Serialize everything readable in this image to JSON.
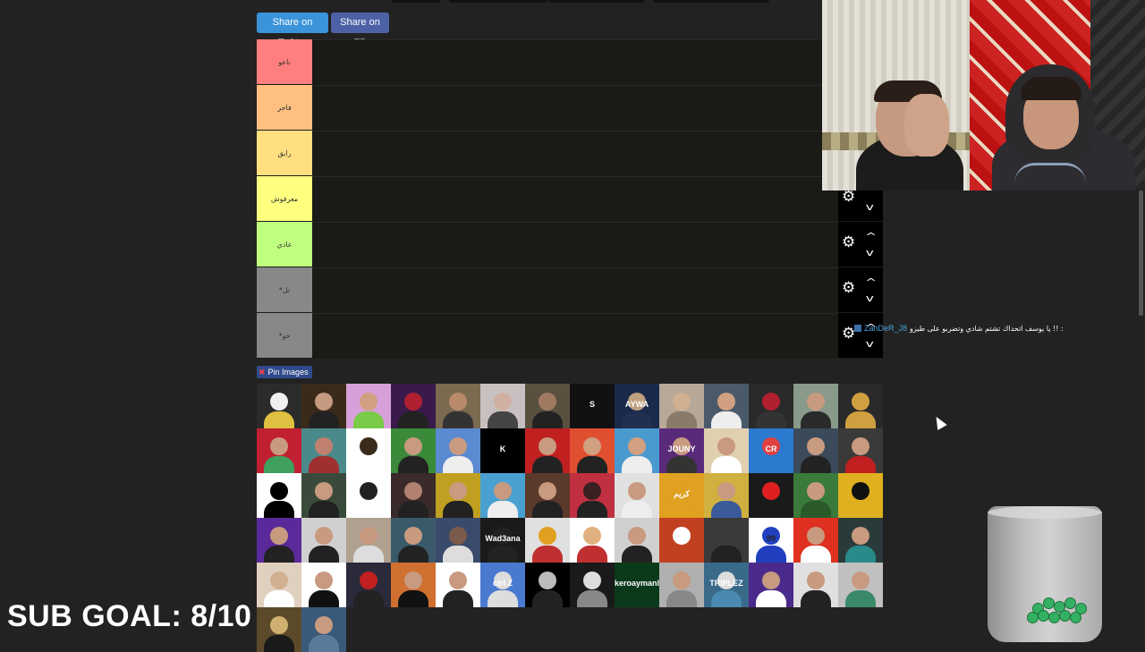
{
  "share": {
    "twitter_label": "Share on Twitter",
    "fb_label": "Share on FB"
  },
  "tiers": [
    {
      "label": "ناعو",
      "color": "#ff7f7f"
    },
    {
      "label": "فاجر",
      "color": "#ffbf7f"
    },
    {
      "label": "رايق",
      "color": "#ffdf7f"
    },
    {
      "label": "معرفوش",
      "color": "#ffff7f"
    },
    {
      "label": "عادي",
      "color": "#bfff7f"
    },
    {
      "label": "*تل",
      "color": "#888888"
    },
    {
      "label": "*خو",
      "color": "#888888"
    }
  ],
  "pin": {
    "label": "Pin Images"
  },
  "pool_tiles": [
    {
      "bg": "#2b2b2b",
      "head": "#f0f0f0",
      "body": "#e0c040",
      "text": ""
    },
    {
      "bg": "#3a2a1a",
      "head": "#c59a80",
      "body": "#222",
      "text": ""
    },
    {
      "bg": "#d8a0d8",
      "head": "#d0a080",
      "body": "#7acb48",
      "text": ""
    },
    {
      "bg": "#3a1a4a",
      "head": "#b02030",
      "body": "#222",
      "text": ""
    },
    {
      "bg": "#7a6a50",
      "head": "#b88a6a",
      "body": "#333",
      "text": ""
    },
    {
      "bg": "#c8c0c0",
      "head": "#d0b0a0",
      "body": "#444",
      "text": ""
    },
    {
      "bg": "#5a5040",
      "head": "#a07a60",
      "body": "#222",
      "text": ""
    },
    {
      "bg": "#111111",
      "head": "#111",
      "body": "#111",
      "text": "S"
    },
    {
      "bg": "#1a2a4a",
      "head": "#c0a080",
      "body": "#203050",
      "text": "AYWA"
    },
    {
      "bg": "#b8a898",
      "head": "#d0b090",
      "body": "#8a7a6a",
      "text": ""
    },
    {
      "bg": "#4a5a6a",
      "head": "#d0a080",
      "body": "#eeeeee",
      "text": ""
    },
    {
      "bg": "#2a2a2a",
      "head": "#b02030",
      "body": "#333",
      "text": ""
    },
    {
      "bg": "#8a9a8a",
      "head": "#c89a80",
      "body": "#2a2a2a",
      "text": ""
    },
    {
      "bg": "#2a2a2a",
      "head": "#d0a040",
      "body": "#d0a040",
      "text": ""
    },
    {
      "bg": "#c02030",
      "head": "#c89a80",
      "body": "#40a060",
      "text": ""
    },
    {
      "bg": "#4a8a8a",
      "head": "#c08070",
      "body": "#a03030",
      "text": ""
    },
    {
      "bg": "#ffffff",
      "head": "#3a2a1a",
      "body": "#ffffff",
      "text": ""
    },
    {
      "bg": "#3a8a3a",
      "head": "#c89a80",
      "body": "#222",
      "text": ""
    },
    {
      "bg": "#5a8ad0",
      "head": "#c89a80",
      "body": "#eeeeee",
      "text": ""
    },
    {
      "bg": "#000000",
      "head": "#000",
      "body": "#000",
      "text": "K"
    },
    {
      "bg": "#c02020",
      "head": "#c89a80",
      "body": "#222",
      "text": ""
    },
    {
      "bg": "#e05030",
      "head": "#d0a080",
      "body": "#222",
      "text": ""
    },
    {
      "bg": "#4a9ad0",
      "head": "#d0a080",
      "body": "#eeeeee",
      "text": ""
    },
    {
      "bg": "#5a2a7a",
      "head": "#c89a80",
      "body": "#333",
      "text": "JOUNY"
    },
    {
      "bg": "#e0d0b0",
      "head": "#c89a80",
      "body": "#ffffff",
      "text": ""
    },
    {
      "bg": "#2a7ad0",
      "head": "#e04040",
      "body": "#2a7ad0",
      "text": "CR"
    },
    {
      "bg": "#3a4a5a",
      "head": "#c89a80",
      "body": "#222",
      "text": ""
    },
    {
      "bg": "#3a3a3a",
      "head": "#c89a80",
      "body": "#c02020",
      "text": ""
    },
    {
      "bg": "#ffffff",
      "head": "#000",
      "body": "#000",
      "text": ""
    },
    {
      "bg": "#3a4a3a",
      "head": "#c89a80",
      "body": "#222",
      "text": ""
    },
    {
      "bg": "#ffffff",
      "head": "#222",
      "body": "#ffffff",
      "text": ""
    },
    {
      "bg": "#3a2a2a",
      "head": "#b08070",
      "body": "#222",
      "text": ""
    },
    {
      "bg": "#c0a020",
      "head": "#c89a80",
      "body": "#222",
      "text": ""
    },
    {
      "bg": "#4aa0d0",
      "head": "#c89a80",
      "body": "#eeeeee",
      "text": ""
    },
    {
      "bg": "#5a3a2a",
      "head": "#c89a80",
      "body": "#222",
      "text": ""
    },
    {
      "bg": "#c03040",
      "head": "#3a2020",
      "body": "#222",
      "text": ""
    },
    {
      "bg": "#e0e0e0",
      "head": "#c89a80",
      "body": "#eeeeee",
      "text": ""
    },
    {
      "bg": "#e0a020",
      "head": "#e0a020",
      "body": "#e0a020",
      "text": "كريم"
    },
    {
      "bg": "#d0b040",
      "head": "#c89a80",
      "body": "#3a5a9a",
      "text": ""
    },
    {
      "bg": "#1a1a1a",
      "head": "#e02020",
      "body": "#1a1a1a",
      "text": ""
    },
    {
      "bg": "#3a7a3a",
      "head": "#c89a80",
      "body": "#2a5a2a",
      "text": ""
    },
    {
      "bg": "#e0b020",
      "head": "#111",
      "body": "#e0b020",
      "text": ""
    },
    {
      "bg": "#5a2a9a",
      "head": "#c89a80",
      "body": "#222",
      "text": ""
    },
    {
      "bg": "#d0d0d0",
      "head": "#c89a80",
      "body": "#222",
      "text": ""
    },
    {
      "bg": "#b0a090",
      "head": "#c89a80",
      "body": "#ddd",
      "text": ""
    },
    {
      "bg": "#3a5a6a",
      "head": "#c89a80",
      "body": "#222",
      "text": ""
    },
    {
      "bg": "#3a4a6a",
      "head": "#7a5a4a",
      "body": "#dddddd",
      "text": ""
    },
    {
      "bg": "#1a1a1a",
      "head": "#222",
      "body": "#222",
      "text": "Wad3ana"
    },
    {
      "bg": "#e0e0e0",
      "head": "#e0a020",
      "body": "#c03030",
      "text": ""
    },
    {
      "bg": "#ffffff",
      "head": "#e0b080",
      "body": "#c03030",
      "text": ""
    },
    {
      "bg": "#d0d0d0",
      "head": "#c89a80",
      "body": "#222",
      "text": ""
    },
    {
      "bg": "#c04020",
      "head": "#ffffff",
      "body": "#c04020",
      "text": ""
    },
    {
      "bg": "#3a3a3a",
      "head": "#3a3a3a",
      "body": "#222",
      "text": ""
    },
    {
      "bg": "#ffffff",
      "head": "#2040c0",
      "body": "#2040c0",
      "text": "99"
    },
    {
      "bg": "#e03020",
      "head": "#c89a80",
      "body": "#ffffff",
      "text": ""
    },
    {
      "bg": "#2a3a3a",
      "head": "#c89a80",
      "body": "#2a8a8a",
      "text": ""
    },
    {
      "bg": "#e0d0c0",
      "head": "#d0b090",
      "body": "#ffffff",
      "text": ""
    },
    {
      "bg": "#ffffff",
      "head": "#c89a80",
      "body": "#111",
      "text": ""
    },
    {
      "bg": "#2a2a3a",
      "head": "#c02020",
      "body": "#222",
      "text": ""
    },
    {
      "bg": "#d07030",
      "head": "#c89a80",
      "body": "#111",
      "text": ""
    },
    {
      "bg": "#ffffff",
      "head": "#c89a80",
      "body": "#222",
      "text": ""
    },
    {
      "bg": "#4a7ad0",
      "head": "#ddd",
      "body": "#ddd",
      "text": "ctrl Z"
    },
    {
      "bg": "#000000",
      "head": "#bbb",
      "body": "#222",
      "text": ""
    },
    {
      "bg": "#1a1a1a",
      "head": "#ddd",
      "body": "#888",
      "text": ""
    },
    {
      "bg": "#0a3a1a",
      "head": "#0a3a1a",
      "body": "#0a3a1a",
      "text": "keroaymanl"
    },
    {
      "bg": "#b0b0b0",
      "head": "#c89a80",
      "body": "#888",
      "text": ""
    },
    {
      "bg": "#3a6a8a",
      "head": "#ddd",
      "body": "#4a8ab0",
      "text": "TRIPLEZ"
    },
    {
      "bg": "#4a2a8a",
      "head": "#c89a80",
      "body": "#ffffff",
      "text": ""
    },
    {
      "bg": "#e0e0e0",
      "head": "#c89a80",
      "body": "#222",
      "text": ""
    },
    {
      "bg": "#c0c0c0",
      "head": "#c89a80",
      "body": "#3a8a6a",
      "text": ""
    },
    {
      "bg": "#5a4a2a",
      "head": "#d0b070",
      "body": "#1a1a1a",
      "text": ""
    },
    {
      "bg": "#3a5a7a",
      "head": "#c89a80",
      "body": "#5a7a9a",
      "text": ""
    }
  ],
  "webcam": {
    "alt": ""
  },
  "chat": {
    "username": "ZanDeR_J8",
    "message": "يا يوسف اتحداك تشتم شادي وتضربو على طيزو !! :"
  },
  "overlay": {
    "sub_goal": "SUB GOAL: 8/10"
  },
  "colors": {
    "background": "#222222",
    "twitter": "#3b94d9",
    "facebook": "#4d62a6"
  }
}
